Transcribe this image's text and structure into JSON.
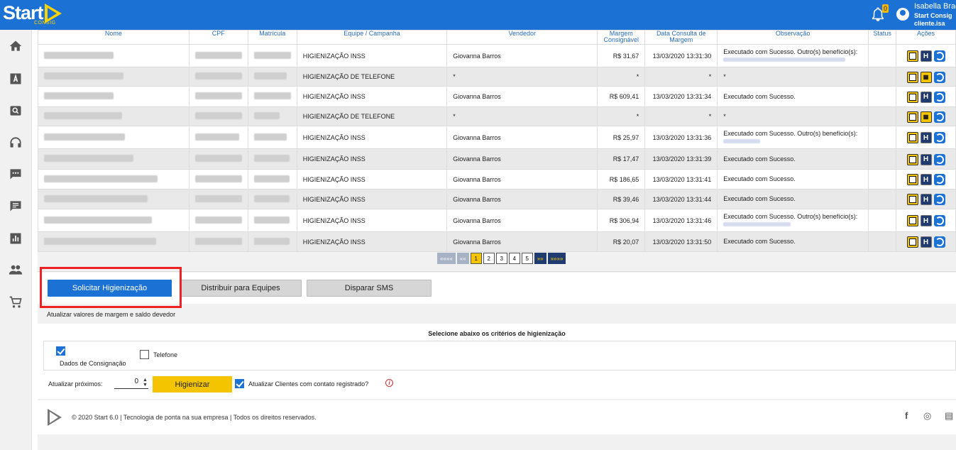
{
  "header": {
    "logo_text": "Start",
    "logo_sub": "CONSIG",
    "notification_count": "0",
    "user_name": "Isabella Braga",
    "user_company": "Start Consig",
    "user_login": "cliente.isa"
  },
  "sidebar": {
    "items": [
      "home-icon",
      "font-icon",
      "search-icon",
      "headset-icon",
      "chat-icon",
      "message-icon",
      "chart-icon",
      "people-icon",
      "cart-icon"
    ]
  },
  "table": {
    "columns": [
      "Nome",
      "CPF",
      "Matrícula",
      "Equipe / Campanha",
      "Vendedor",
      "Margem Consignável",
      "Data Consulta de Margem",
      "Observação",
      "Status",
      "Ações"
    ],
    "rows": [
      {
        "equipe": "HIGIENIZAÇÃO INSS",
        "vendedor": "Giovanna Barros",
        "margem": "R$ 31,67",
        "data": "13/03/2020 13:31:30",
        "obs": "Executado com Sucesso. Outro(s) benefício(s):",
        "extra": true,
        "calc": false
      },
      {
        "equipe": "HIGIENIZAÇÃO DE TELEFONE",
        "vendedor": "*",
        "margem": "*",
        "data": "*",
        "obs": "*",
        "extra": false,
        "calc": true
      },
      {
        "equipe": "HIGIENIZAÇÃO INSS",
        "vendedor": "Giovanna Barros",
        "margem": "R$ 609,41",
        "data": "13/03/2020 13:31:34",
        "obs": "Executado com Sucesso.",
        "extra": false,
        "calc": false
      },
      {
        "equipe": "HIGIENIZAÇÃO DE TELEFONE",
        "vendedor": "*",
        "margem": "*",
        "data": "*",
        "obs": "*",
        "extra": false,
        "calc": true
      },
      {
        "equipe": "HIGIENIZAÇÃO INSS",
        "vendedor": "Giovanna Barros",
        "margem": "R$ 25,97",
        "data": "13/03/2020 13:31:36",
        "obs": "Executado com Sucesso. Outro(s) benefício(s):",
        "extra": true,
        "calc": false
      },
      {
        "equipe": "HIGIENIZAÇÃO INSS",
        "vendedor": "Giovanna Barros",
        "margem": "R$ 17,47",
        "data": "13/03/2020 13:31:39",
        "obs": "Executado com Sucesso.",
        "extra": false,
        "calc": false
      },
      {
        "equipe": "HIGIENIZAÇÃO INSS",
        "vendedor": "Giovanna Barros",
        "margem": "R$ 186,65",
        "data": "13/03/2020 13:31:41",
        "obs": "Executado com Sucesso.",
        "extra": false,
        "calc": false
      },
      {
        "equipe": "HIGIENIZAÇÃO INSS",
        "vendedor": "Giovanna Barros",
        "margem": "R$ 39,46",
        "data": "13/03/2020 13:31:44",
        "obs": "Executado com Sucesso.",
        "extra": false,
        "calc": false
      },
      {
        "equipe": "HIGIENIZAÇÃO INSS",
        "vendedor": "Giovanna Barros",
        "margem": "R$ 306,94",
        "data": "13/03/2020 13:31:46",
        "obs": "Executado com Sucesso. Outro(s) benefício(s):",
        "extra": true,
        "calc": false
      },
      {
        "equipe": "HIGIENIZAÇÃO INSS",
        "vendedor": "Giovanna Barros",
        "margem": "R$ 20,07",
        "data": "13/03/2020 13:31:50",
        "obs": "Executado com Sucesso.",
        "extra": false,
        "calc": false
      }
    ]
  },
  "pagination": {
    "first": "««««",
    "prev": "««",
    "pages": [
      "1",
      "2",
      "3",
      "4",
      "5"
    ],
    "current": "1",
    "next": "»»",
    "last": "»»»»"
  },
  "actions": {
    "solicitar": "Solicitar Higienização",
    "distribuir": "Distribuir para Equipes",
    "disparar": "Disparar SMS"
  },
  "hint": "Atualizar valores de margem e saldo devedor",
  "criteria": {
    "title": "Selecione abaixo os critérios de higienização",
    "dados_label": "Dados de Consignação",
    "dados_checked": true,
    "telefone_label": "Telefone",
    "telefone_checked": false,
    "atualizar_label": "Atualizar próximos:",
    "atualizar_value": "0",
    "higienizar_label": "Higienizar",
    "contato_label": "Atualizar Clientes com contato registrado?",
    "contato_checked": true,
    "info_glyph": "i"
  },
  "footer": {
    "text": "© 2020 Start 6.0 | Tecnologia de ponta na sua empresa | Todos os direitos reservados.",
    "facebook": "f",
    "instagram": "◎",
    "other": "▤"
  },
  "colors": {
    "primary": "#1c72d4",
    "accent": "#f5c400",
    "navy": "#1f3b6f",
    "highlight": "#e22222"
  }
}
